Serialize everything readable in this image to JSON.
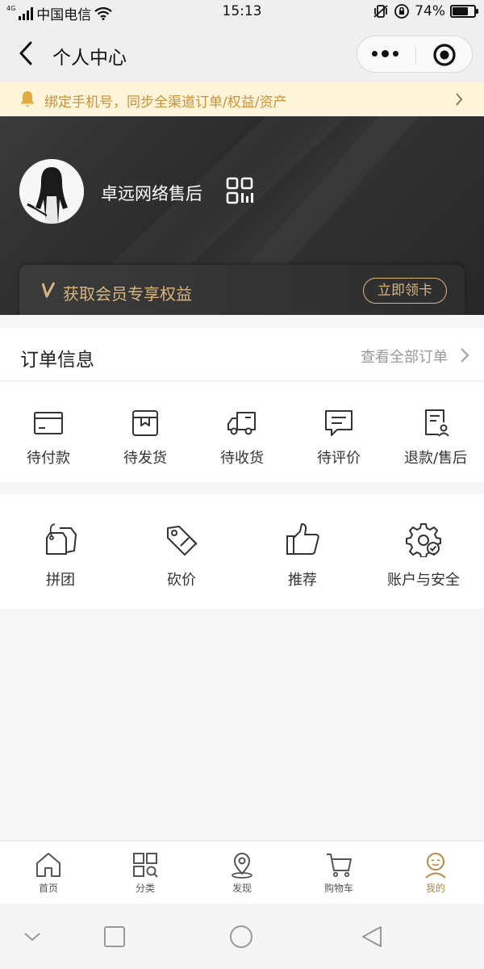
{
  "status_bar": {
    "network_type": "4G",
    "carrier": "中国电信",
    "time": "15:13",
    "battery_percent": "74%",
    "battery_level": 0.74
  },
  "nav": {
    "title": "个人中心",
    "back_icon": "chevron-left-icon",
    "more_icon": "more-dots-icon",
    "close_icon": "target-circle-icon"
  },
  "notice": {
    "text": "绑定手机号，同步全渠道订单/权益/资产",
    "icon": "bell-icon"
  },
  "profile": {
    "username": "卓远网络售后",
    "qr_icon": "qr-code-icon"
  },
  "vip": {
    "text": "获取会员专享权益",
    "button": "立即领卡",
    "accent": "#d8b57d"
  },
  "orders": {
    "title": "订单信息",
    "view_all": "查看全部订单",
    "items": [
      {
        "label": "待付款",
        "icon": "card-icon"
      },
      {
        "label": "待发货",
        "icon": "box-icon"
      },
      {
        "label": "待收货",
        "icon": "truck-icon"
      },
      {
        "label": "待评价",
        "icon": "comment-icon"
      },
      {
        "label": "退款/售后",
        "icon": "refund-doc-icon"
      }
    ]
  },
  "tools": {
    "items": [
      {
        "label": "拼团",
        "icon": "tags-icon"
      },
      {
        "label": "砍价",
        "icon": "price-tag-icon"
      },
      {
        "label": "推荐",
        "icon": "thumbs-up-icon"
      },
      {
        "label": "账户与安全",
        "icon": "gear-check-icon"
      }
    ]
  },
  "tabbar": {
    "active_color": "#b68a42",
    "items": [
      {
        "label": "首页",
        "icon": "home-icon"
      },
      {
        "label": "分类",
        "icon": "category-icon"
      },
      {
        "label": "发现",
        "icon": "location-icon"
      },
      {
        "label": "购物车",
        "icon": "cart-icon"
      },
      {
        "label": "我的",
        "icon": "user-face-icon"
      }
    ]
  }
}
